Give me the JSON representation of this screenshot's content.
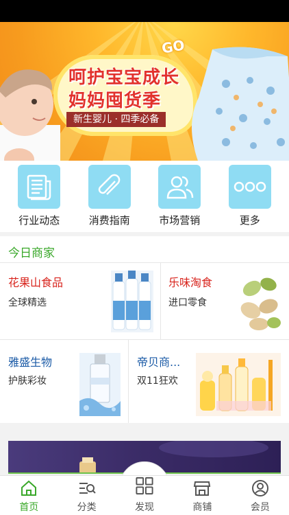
{
  "banner": {
    "go_text": "GO",
    "title_line1": "呵护宝宝成长",
    "title_line2": "妈妈囤货季",
    "subtitle": "新生婴儿 · 四季必备"
  },
  "categories": [
    {
      "label": "行业动态",
      "icon": "newspaper-icon"
    },
    {
      "label": "消费指南",
      "icon": "paperclip-icon"
    },
    {
      "label": "市场营销",
      "icon": "people-icon"
    },
    {
      "label": "更多",
      "icon": "more-dots-icon"
    }
  ],
  "today": {
    "title": "今日商家",
    "merchants": [
      {
        "name": "花果山食品",
        "desc": "全球精选",
        "color": "#d8241d",
        "image": "milk-bottles-image"
      },
      {
        "name": "乐味淘食",
        "desc": "进口零食",
        "color": "#d8241d",
        "image": "pistachio-image"
      },
      {
        "name": "雅盛生物",
        "desc": "护肤彩妆",
        "color": "#1a5aa6",
        "image": "skincare-bottle-image"
      },
      {
        "name": "帝贝商...",
        "desc": "双11狂欢",
        "color": "#1a5aa6",
        "image": "baby-bottles-image"
      }
    ]
  },
  "nav": [
    {
      "label": "首页",
      "icon": "home-icon",
      "active": true
    },
    {
      "label": "分类",
      "icon": "category-search-icon",
      "active": false
    },
    {
      "label": "发现",
      "icon": "grid-icon",
      "active": false
    },
    {
      "label": "商铺",
      "icon": "shop-icon",
      "active": false
    },
    {
      "label": "会员",
      "icon": "user-icon",
      "active": false
    }
  ]
}
